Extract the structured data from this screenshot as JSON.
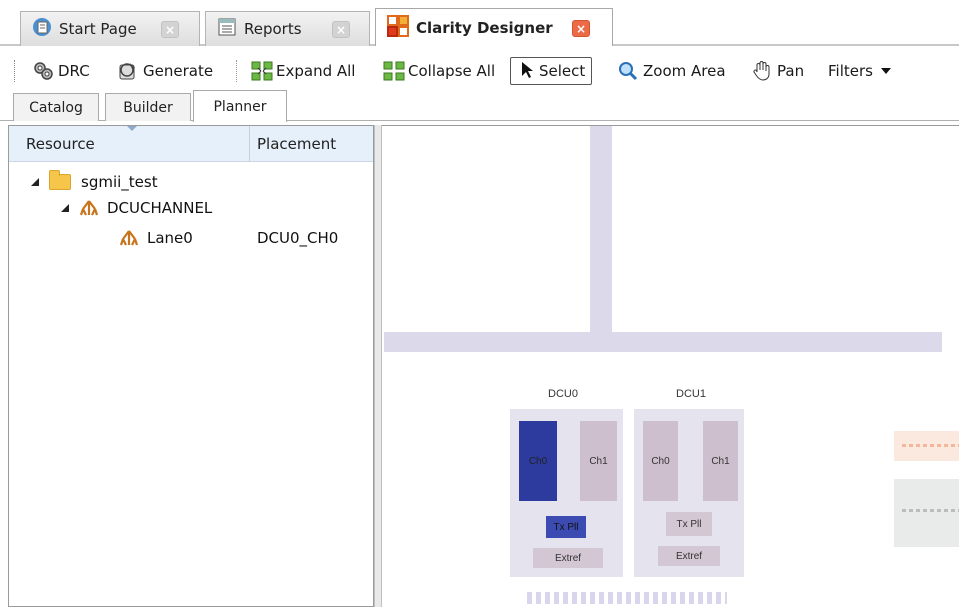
{
  "doc_tabs": [
    {
      "label": "Start Page",
      "active": false
    },
    {
      "label": "Reports",
      "active": false
    },
    {
      "label": "Clarity Designer",
      "active": true
    }
  ],
  "toolbar": {
    "drc": "DRC",
    "generate": "Generate",
    "expand_all": "Expand All",
    "collapse_all": "Collapse All",
    "select": "Select",
    "zoom_area": "Zoom Area",
    "pan": "Pan",
    "filters": "Filters"
  },
  "panel_tabs": [
    {
      "label": "Catalog",
      "active": false
    },
    {
      "label": "Builder",
      "active": false
    },
    {
      "label": "Planner",
      "active": true
    }
  ],
  "resource_table": {
    "headers": {
      "resource": "Resource",
      "placement": "Placement"
    },
    "rows": [
      {
        "label": "sgmii_test",
        "placement": "",
        "icon": "folder-icon"
      },
      {
        "label": "DCUCHANNEL",
        "placement": "",
        "icon": "channel-icon"
      },
      {
        "label": "Lane0",
        "placement": "DCU0_CH0",
        "icon": "channel-icon"
      }
    ]
  },
  "canvas": {
    "dcus": [
      {
        "label": "DCU0",
        "ch0": "Ch0",
        "ch1": "Ch1",
        "txpll": "Tx Pll",
        "extref": "Extref",
        "selected_channel": "Ch0"
      },
      {
        "label": "DCU1",
        "ch0": "Ch0",
        "ch1": "Ch1",
        "txpll": "Tx Pll",
        "extref": "Extref",
        "selected_channel": ""
      }
    ]
  },
  "colors": {
    "selected_channel": "#2e3b9e",
    "bus": "#dbd9ea",
    "channel": "#cdbfcd",
    "header_bg": "#e6f0fb",
    "close_active": "#ec6b47"
  }
}
